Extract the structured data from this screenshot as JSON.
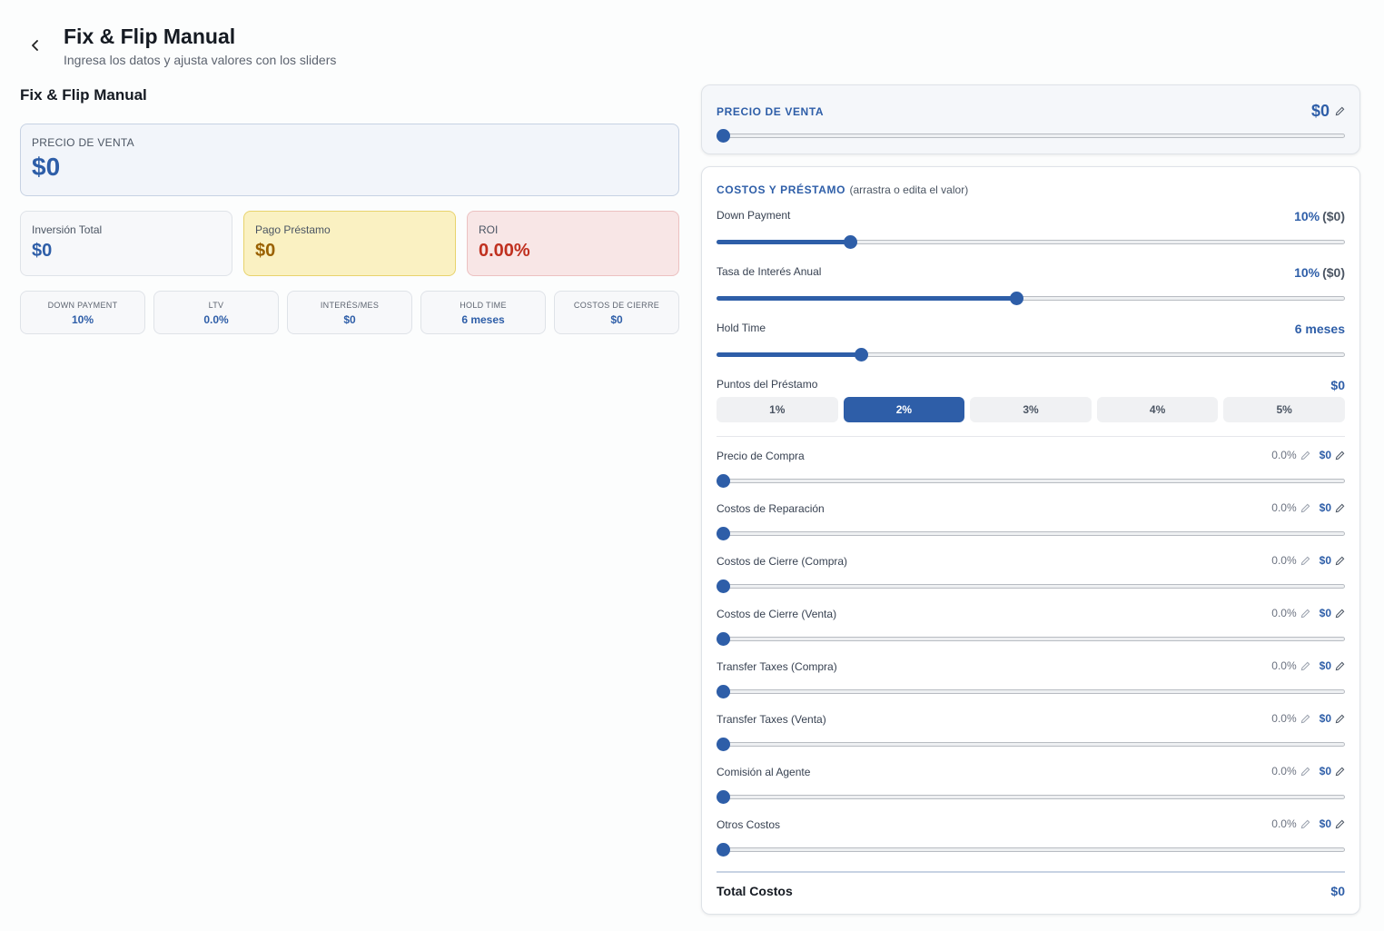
{
  "header": {
    "back_icon": "chevron-left-icon",
    "title": "Fix & Flip Manual",
    "subtitle": "Ingresa los datos y ajusta valores con los sliders"
  },
  "left": {
    "section_title": "Fix & Flip Manual",
    "hero": {
      "label": "PRECIO DE VENTA",
      "value": "$0"
    },
    "cards": {
      "investment": {
        "label": "Inversión Total",
        "value": "$0"
      },
      "loan_payment": {
        "label": "Pago Préstamo",
        "value": "$0"
      },
      "roi": {
        "label": "ROI",
        "value": "0.00%"
      }
    },
    "minis": {
      "down_payment": {
        "label": "DOWN PAYMENT",
        "value": "10%"
      },
      "ltv": {
        "label": "LTV",
        "value": "0.0%"
      },
      "interest": {
        "label": "INTERÉS/MES",
        "value": "$0"
      },
      "hold": {
        "label": "HOLD TIME",
        "value": "6 meses"
      },
      "closing": {
        "label": "COSTOS DE CIERRE",
        "value": "$0"
      }
    }
  },
  "sale_panel": {
    "label": "PRECIO DE VENTA",
    "value": "$0",
    "slider_fraction": 0.0
  },
  "costs_panel": {
    "title": "COSTOS Y PRÉSTAMO",
    "note": "(arrastra o edita el valor)",
    "down_payment": {
      "label": "Down Payment",
      "value": "10%",
      "amount": "($0)",
      "slider_fraction": 0.206
    },
    "interest_rate": {
      "label": "Tasa de Interés Anual",
      "value": "10%",
      "amount": "($0)",
      "slider_fraction": 0.476
    },
    "hold_time": {
      "label": "Hold Time",
      "value": "6 meses",
      "slider_fraction": 0.224
    },
    "points": {
      "label": "Puntos del Préstamo",
      "value": "$0",
      "options": [
        "1%",
        "2%",
        "3%",
        "4%",
        "5%"
      ],
      "selected": "2%"
    },
    "costs": [
      {
        "label": "Precio de Compra",
        "pct": "0.0%",
        "amount": "$0",
        "slider_fraction": 0.0
      },
      {
        "label": "Costos de Reparación",
        "pct": "0.0%",
        "amount": "$0",
        "slider_fraction": 0.0
      },
      {
        "label": "Costos de Cierre (Compra)",
        "pct": "0.0%",
        "amount": "$0",
        "slider_fraction": 0.0
      },
      {
        "label": "Costos de Cierre (Venta)",
        "pct": "0.0%",
        "amount": "$0",
        "slider_fraction": 0.0
      },
      {
        "label": "Transfer Taxes (Compra)",
        "pct": "0.0%",
        "amount": "$0",
        "slider_fraction": 0.0
      },
      {
        "label": "Transfer Taxes (Venta)",
        "pct": "0.0%",
        "amount": "$0",
        "slider_fraction": 0.0
      },
      {
        "label": "Comisión al Agente",
        "pct": "0.0%",
        "amount": "$0",
        "slider_fraction": 0.0
      },
      {
        "label": "Otros Costos",
        "pct": "0.0%",
        "amount": "$0",
        "slider_fraction": 0.0
      }
    ],
    "total": {
      "label": "Total Costos",
      "value": "$0"
    }
  },
  "colors": {
    "accent": "#2e5ea8",
    "warning_bg": "#faf1c2",
    "danger_bg": "#f8e6e6",
    "danger_text": "#c0301f"
  },
  "icons": {
    "edit": "pencil-icon"
  }
}
